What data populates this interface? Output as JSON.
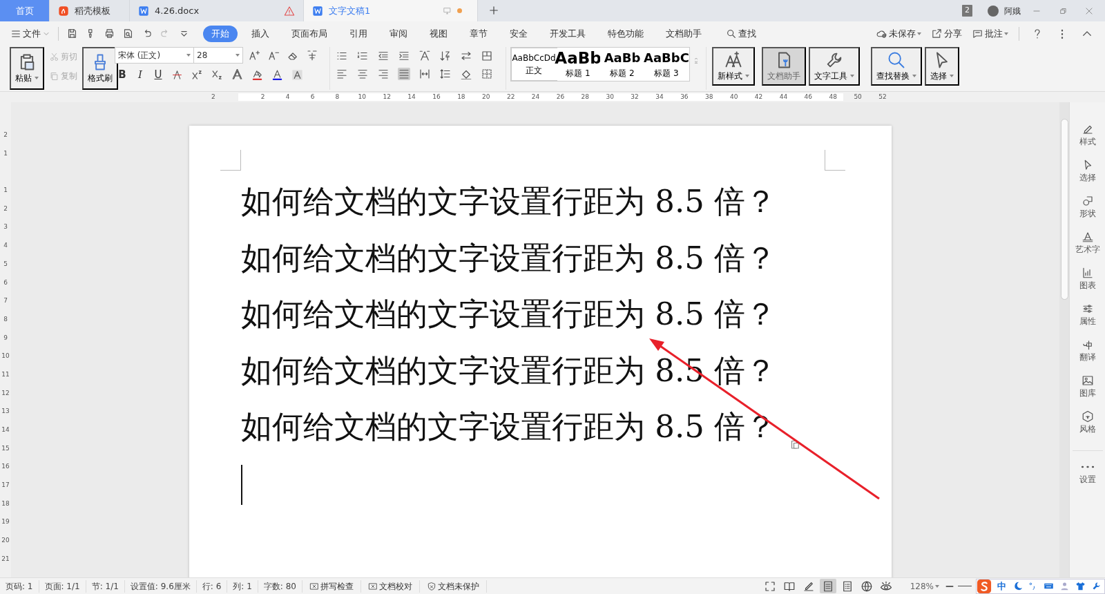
{
  "window_tabs": [
    {
      "label": "首页",
      "kind": "home",
      "selected": false
    },
    {
      "label": "稻壳模板",
      "kind": "docer",
      "selected": false
    },
    {
      "label": "4.26.docx",
      "kind": "doc",
      "selected": false,
      "warning": true
    },
    {
      "label": "文字文稿1",
      "kind": "doc",
      "selected": true,
      "unsaved": true
    }
  ],
  "title_bar": {
    "window_count": "2",
    "user": "阿娥"
  },
  "menu": {
    "file": "文件",
    "tabs": [
      {
        "label": "开始",
        "selected": true
      },
      {
        "label": "插入",
        "selected": false
      },
      {
        "label": "页面布局",
        "selected": false
      },
      {
        "label": "引用",
        "selected": false
      },
      {
        "label": "审阅",
        "selected": false
      },
      {
        "label": "视图",
        "selected": false
      },
      {
        "label": "章节",
        "selected": false
      },
      {
        "label": "安全",
        "selected": false
      },
      {
        "label": "开发工具",
        "selected": false
      },
      {
        "label": "特色功能",
        "selected": false
      },
      {
        "label": "文档助手",
        "selected": false
      }
    ],
    "search": "查找",
    "actions": [
      "未保存",
      "分享",
      "批注"
    ]
  },
  "ribbon": {
    "paste": "粘贴",
    "cut": {
      "label": "剪切",
      "disabled": true
    },
    "copy": {
      "label": "复制",
      "disabled": true
    },
    "format_painter": "格式刷",
    "font_name": "宋体 (正文)",
    "font_size": "28",
    "format_buttons": [
      "B",
      "I",
      "U"
    ],
    "styles": [
      {
        "preview": "AaBbCcDd",
        "label": "正文",
        "selected": true
      },
      {
        "preview": "AaBb",
        "label": "标题 1",
        "selected": false
      },
      {
        "preview": "AaBb",
        "label": "标题 2",
        "selected": false
      },
      {
        "preview": "AaBbC",
        "label": "标题 3",
        "selected": false
      }
    ],
    "tools": [
      {
        "label": "新样式",
        "selected": false
      },
      {
        "label": "文档助手",
        "selected": true
      },
      {
        "label": "文字工具",
        "selected": false
      },
      {
        "label": "查找替换",
        "selected": false
      },
      {
        "label": "选择",
        "selected": false
      }
    ]
  },
  "ruler": {
    "h_ticks": [
      "2",
      "2",
      "4",
      "6",
      "8",
      "10",
      "12",
      "14",
      "16",
      "18",
      "20",
      "22",
      "24",
      "26",
      "28",
      "30",
      "32",
      "34",
      "36",
      "38",
      "40",
      "42",
      "44",
      "46",
      "48",
      "50",
      "52"
    ],
    "v_ticks": [
      "2",
      "1",
      "1",
      "2",
      "3",
      "4",
      "5",
      "6",
      "7",
      "8",
      "9",
      "10",
      "11",
      "12",
      "13",
      "14",
      "15",
      "16",
      "17",
      "18",
      "19",
      "20",
      "21"
    ]
  },
  "document": {
    "lines": [
      "如何给文档的文字设置行距为 8.5 倍？",
      "如何给文档的文字设置行距为 8.5 倍？",
      "如何给文档的文字设置行距为 8.5 倍？",
      "如何给文档的文字设置行距为 8.5 倍？",
      "如何给文档的文字设置行距为 8.5 倍？"
    ],
    "cursor": true
  },
  "sidebar": [
    "样式",
    "选择",
    "形状",
    "艺术字",
    "图表",
    "属性",
    "翻译",
    "图库",
    "风格",
    "设置"
  ],
  "status_bar": {
    "items": [
      "页码: 1",
      "页面: 1/1",
      "节: 1/1",
      "设置值: 9.6厘米",
      "行: 6",
      "列: 1",
      "字数: 80"
    ],
    "checks": [
      "拼写检查",
      "文档校对",
      "文档未保护"
    ],
    "views": [
      {
        "selected": false
      },
      {
        "selected": false
      },
      {
        "selected": false
      },
      {
        "selected": true
      },
      {
        "selected": false
      },
      {
        "selected": false
      },
      {
        "selected": false
      }
    ],
    "zoom": "128%"
  },
  "ime": {
    "mode": "中"
  }
}
